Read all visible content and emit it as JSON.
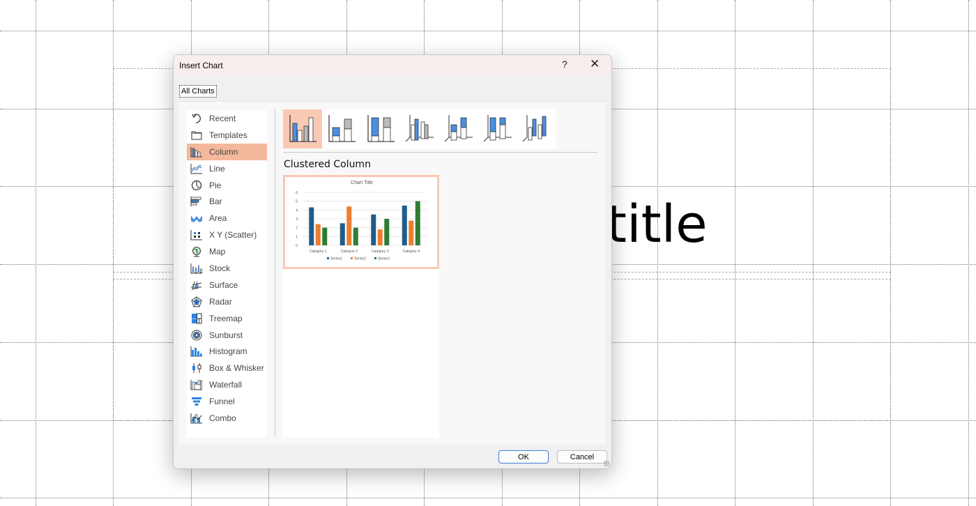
{
  "slide": {
    "title_text": "title"
  },
  "dialog": {
    "title": "Insert Chart",
    "help_label": "?",
    "close_label": "✕",
    "tab_label": "All Charts",
    "chart_types": [
      {
        "label": "Recent",
        "icon": "recent-icon"
      },
      {
        "label": "Templates",
        "icon": "folder-icon"
      },
      {
        "label": "Column",
        "icon": "column-chart-icon",
        "selected": true
      },
      {
        "label": "Line",
        "icon": "line-chart-icon"
      },
      {
        "label": "Pie",
        "icon": "pie-chart-icon"
      },
      {
        "label": "Bar",
        "icon": "bar-chart-icon"
      },
      {
        "label": "Area",
        "icon": "area-chart-icon"
      },
      {
        "label": "X Y (Scatter)",
        "icon": "scatter-chart-icon"
      },
      {
        "label": "Map",
        "icon": "map-chart-icon"
      },
      {
        "label": "Stock",
        "icon": "stock-chart-icon"
      },
      {
        "label": "Surface",
        "icon": "surface-chart-icon"
      },
      {
        "label": "Radar",
        "icon": "radar-chart-icon"
      },
      {
        "label": "Treemap",
        "icon": "treemap-chart-icon"
      },
      {
        "label": "Sunburst",
        "icon": "sunburst-chart-icon"
      },
      {
        "label": "Histogram",
        "icon": "histogram-chart-icon"
      },
      {
        "label": "Box & Whisker",
        "icon": "box-whisker-chart-icon"
      },
      {
        "label": "Waterfall",
        "icon": "waterfall-chart-icon"
      },
      {
        "label": "Funnel",
        "icon": "funnel-chart-icon"
      },
      {
        "label": "Combo",
        "icon": "combo-chart-icon"
      }
    ],
    "subtypes": [
      {
        "name": "clustered-column",
        "selected": true
      },
      {
        "name": "stacked-column"
      },
      {
        "name": "100-stacked-column"
      },
      {
        "name": "3d-clustered-column"
      },
      {
        "name": "3d-stacked-column"
      },
      {
        "name": "3d-100-stacked-column"
      },
      {
        "name": "3d-column"
      }
    ],
    "selected_subtype_name": "Clustered Column",
    "ok_label": "OK",
    "cancel_label": "Cancel",
    "colors": {
      "accent": "#f4b89c",
      "series1": "#1f5c8b",
      "series2": "#ed7d31",
      "series3": "#2e7d32"
    }
  },
  "chart_data": {
    "type": "bar",
    "title": "Chart Title",
    "categories": [
      "Category 1",
      "Category 2",
      "Category 3",
      "Category 4"
    ],
    "series": [
      {
        "name": "Series1",
        "values": [
          4.3,
          2.5,
          3.5,
          4.5
        ]
      },
      {
        "name": "Series2",
        "values": [
          2.4,
          4.4,
          1.8,
          2.8
        ]
      },
      {
        "name": "Series3",
        "values": [
          2,
          2,
          3,
          5
        ]
      }
    ],
    "yticks": [
      "0",
      "1",
      "2",
      "3",
      "4",
      "5",
      "6"
    ],
    "ylim": [
      0,
      6
    ],
    "xlabel": "",
    "ylabel": "",
    "grid": true,
    "legend": "bottom"
  }
}
